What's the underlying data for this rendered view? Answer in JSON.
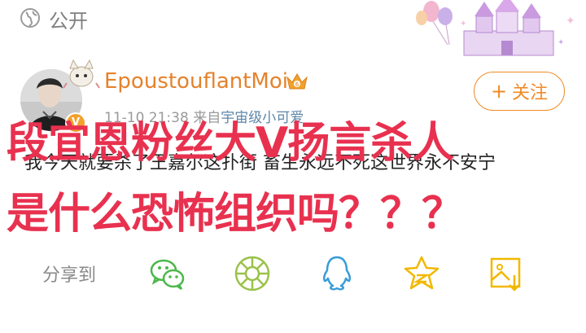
{
  "header": {
    "visibility_label": "公开",
    "globe_icon": "globe-icon",
    "decoration_icon": "castle-balloons-sticker"
  },
  "post": {
    "username": "EpoustouflantMoi",
    "verified_badge": "V",
    "crown_icon": "vip-crown-icon",
    "timestamp": "11-10 21:38",
    "source_prefix": "来自",
    "source_name": "宇宙级小可爱",
    "follow_label": "关注",
    "follow_plus": "+",
    "content": "我今天就要杀了王嘉尔这扑街 畜生永远不死这世界永不安宁"
  },
  "overlay_text": {
    "line1": "段宜恩粉丝大V扬言杀人",
    "line2": "是什么恐怖组织吗？？？"
  },
  "share": {
    "label": "分享到",
    "targets": [
      "wechat-icon",
      "moments-icon",
      "qq-icon",
      "qzone-icon",
      "save-image-icon"
    ]
  },
  "colors": {
    "username": "#e5822c",
    "follow": "#f08a24",
    "overlay": "#e8314f",
    "source": "#5e86a9",
    "wechat": "#4cb84a",
    "moments": "#9ac24a",
    "qq": "#3a9cd8",
    "qzone": "#f2b800"
  }
}
